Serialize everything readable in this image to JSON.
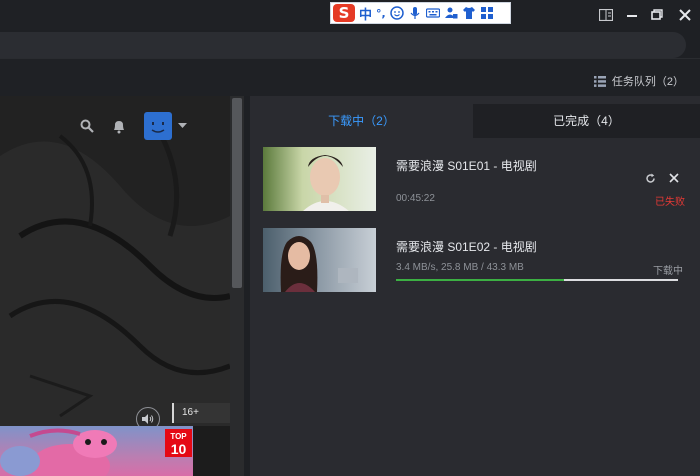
{
  "window": {
    "ime_text": "中",
    "ime_punct": "°,",
    "ime_logo": "S"
  },
  "toolbar": {
    "queue_label": "任务队列（2）"
  },
  "left": {
    "age_rating": "16+",
    "top10_line1": "TOP",
    "top10_line2": "10"
  },
  "downloads": {
    "tabs": [
      {
        "label": "下载中（2）",
        "active": true
      },
      {
        "label": "已完成（4）",
        "active": false
      }
    ],
    "items": [
      {
        "title": "需要浪漫 S01E01 - 电视剧",
        "meta": "00:45:22",
        "status": "已失败",
        "status_color": "#e53935"
      },
      {
        "title": "需要浪漫 S01E02 - 电视剧",
        "meta": "3.4 MB/s, 25.8 MB / 43.3 MB",
        "status": "下载中",
        "status_color": "#9a9ea4",
        "progress": 0.596
      }
    ]
  },
  "colors": {
    "accent": "#3a9bff",
    "error": "#e53935",
    "progress": "#3cb043"
  }
}
